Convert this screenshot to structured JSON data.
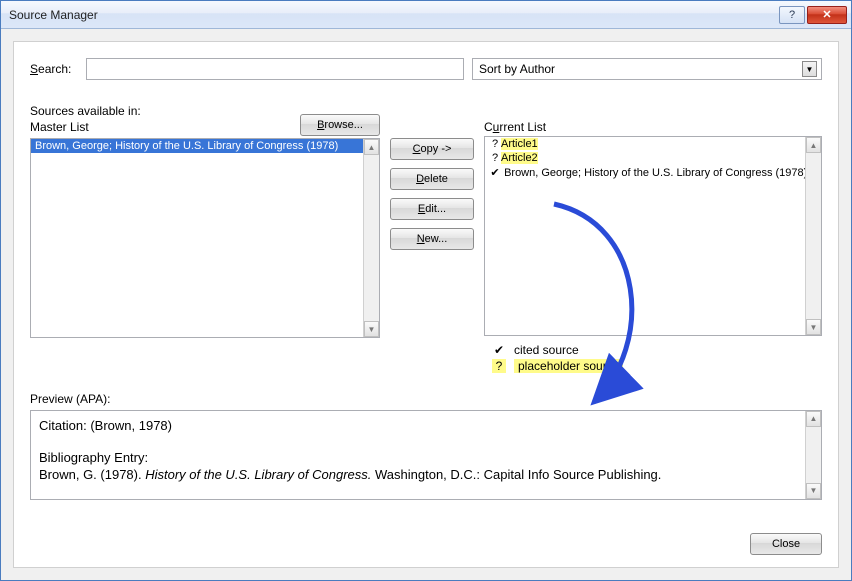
{
  "window": {
    "title": "Source Manager"
  },
  "search": {
    "label": "Search:",
    "value": ""
  },
  "sort": {
    "selected": "Sort by Author"
  },
  "sources_available_label": "Sources available in:",
  "browse_label": "Browse...",
  "master": {
    "label": "Master List",
    "items": [
      {
        "text": "Brown, George; History of the U.S. Library of Congress (1978)",
        "selected": true
      }
    ]
  },
  "buttons": {
    "copy": "Copy ->",
    "delete": "Delete",
    "edit": "Edit...",
    "new": "New..."
  },
  "current": {
    "label": "Current List",
    "items": [
      {
        "mark": "?",
        "text": "Article1",
        "highlight": true
      },
      {
        "mark": "?",
        "text": "Article2",
        "highlight": true
      },
      {
        "mark": "✔",
        "text": "Brown, George; History of the U.S. Library of Congress (1978)",
        "highlight": false
      }
    ]
  },
  "legend": {
    "cited": {
      "mark": "✔",
      "text": "cited source"
    },
    "placeholder": {
      "mark": "?",
      "text": "placeholder source"
    }
  },
  "preview": {
    "label": "Preview (APA):",
    "citation_label": "Citation:",
    "citation_value": "(Brown, 1978)",
    "bib_label": "Bibliography Entry:",
    "bib_author": "Brown, G. (1978).",
    "bib_title": "History of the U.S. Library of Congress.",
    "bib_rest": "Washington, D.C.: Capital Info Source Publishing."
  },
  "close_label": "Close"
}
